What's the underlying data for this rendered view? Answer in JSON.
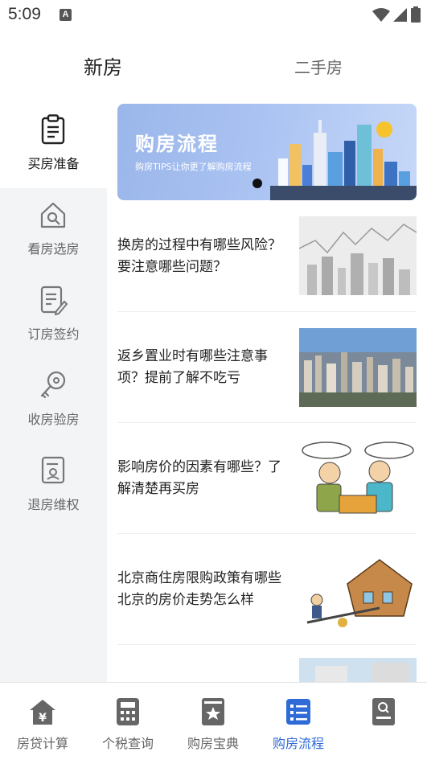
{
  "status_bar": {
    "time": "5:09",
    "notification_glyph": "A",
    "icons": [
      "wifi-icon",
      "signal-icon",
      "battery-icon"
    ]
  },
  "top_tabs": [
    {
      "label": "新房",
      "active": true
    },
    {
      "label": "二手房",
      "active": false
    }
  ],
  "sidebar": {
    "items": [
      {
        "label": "买房准备",
        "icon": "clipboard-icon",
        "active": true
      },
      {
        "label": "看房选房",
        "icon": "house-search-icon",
        "active": false
      },
      {
        "label": "订房签约",
        "icon": "sign-document-icon",
        "active": false
      },
      {
        "label": "收房验房",
        "icon": "key-icon",
        "active": false
      },
      {
        "label": "退房维权",
        "icon": "refund-document-icon",
        "active": false
      }
    ]
  },
  "banner": {
    "title": "购房流程",
    "subtitle": "购房TIPS让你更了解购房流程"
  },
  "articles": [
    {
      "title": "换房的过程中有哪些风险？要注意哪些问题？",
      "thumb": "city-chart-sketch"
    },
    {
      "title": "返乡置业时有哪些注意事项？提前了解不吃亏",
      "thumb": "city-aerial-photo"
    },
    {
      "title": "影响房价的因素有哪些？了解清楚再买房",
      "thumb": "cartoon-negotiation"
    },
    {
      "title": "北京商住房限购政策有哪些北京的房价走势怎么样",
      "thumb": "house-seesaw-cartoon"
    },
    {
      "title": "",
      "thumb": "building-photo"
    }
  ],
  "bottom_nav": [
    {
      "label": "房贷计算",
      "icon": "loan-calculator-icon",
      "active": false
    },
    {
      "label": "个税查询",
      "icon": "tax-calculator-icon",
      "active": false
    },
    {
      "label": "购房宝典",
      "icon": "guide-book-icon",
      "active": false
    },
    {
      "label": "购房流程",
      "icon": "process-list-icon",
      "active": true
    },
    {
      "label": "",
      "icon": "profile-search-icon",
      "active": false
    }
  ],
  "colors": {
    "accent": "#2f6bd6",
    "icon_gray": "#666666",
    "sidebar_bg": "#f3f4f6"
  }
}
